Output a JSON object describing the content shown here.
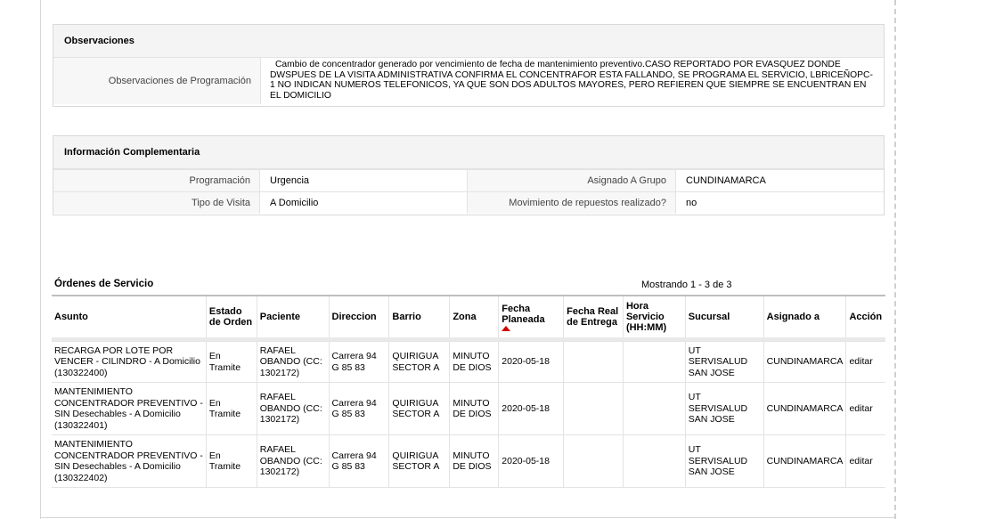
{
  "observaciones": {
    "title": "Observaciones",
    "label": "Observaciones de Programación",
    "text": "Cambio de concentrador generado por vencimiento de fecha de mantenimiento preventivo.CASO REPORTADO POR EVASQUEZ DONDE DWSPUES DE LA VISITA ADMINISTRATIVA CONFIRMA EL CONCENTRAFOR ESTA FALLANDO, SE PROGRAMA EL SERVICIO, LBRICEÑOPC-1 NO INDICAN NUMEROS TELEFONICOS, YA QUE SON DOS ADULTOS MAYORES, PERO REFIEREN QUE SIEMPRE SE ENCUENTRAN EN EL DOMICILIO"
  },
  "info": {
    "title": "Información Complementaria",
    "rows": [
      {
        "label1": "Programación",
        "value1": "Urgencia",
        "label2": "Asignado A Grupo",
        "value2": "CUNDINAMARCA"
      },
      {
        "label1": "Tipo de Visita",
        "value1": "A Domicilio",
        "label2": "Movimiento de repuestos realizado?",
        "value2": "no"
      }
    ]
  },
  "orders": {
    "title": "Órdenes de Servicio",
    "count_text": "Mostrando 1 - 3 de 3",
    "headers": [
      "Asunto",
      "Estado de Orden",
      "Paciente",
      "Direccion",
      "Barrio",
      "Zona",
      "Fecha Planeada",
      "Fecha Real de Entrega",
      "Hora Servicio (HH:MM)",
      "Sucursal",
      "Asignado a",
      "Acción"
    ],
    "rows": [
      {
        "asunto": "RECARGA POR LOTE POR VENCER - CILINDRO - A Domicilio (130322400)",
        "estado": "En Tramite",
        "paciente": "RAFAEL OBANDO (CC: 1302172)",
        "direccion": "Carrera 94 G 85 83",
        "barrio": "QUIRIGUA SECTOR A",
        "zona": "MINUTO DE DIOS",
        "fecha": "2020-05-18",
        "fecha_real": "",
        "hora": "",
        "sucursal": "UT SERVISALUD SAN JOSE",
        "asignado": "CUNDINAMARCA",
        "accion": "editar"
      },
      {
        "asunto": "MANTENIMIENTO CONCENTRADOR PREVENTIVO - SIN Desechables - A Domicilio (130322401)",
        "estado": "En Tramite",
        "paciente": "RAFAEL OBANDO (CC: 1302172)",
        "direccion": "Carrera 94 G 85 83",
        "barrio": "QUIRIGUA SECTOR A",
        "zona": "MINUTO DE DIOS",
        "fecha": "2020-05-18",
        "fecha_real": "",
        "hora": "",
        "sucursal": "UT SERVISALUD SAN JOSE",
        "asignado": "CUNDINAMARCA",
        "accion": "editar"
      },
      {
        "asunto": "MANTENIMIENTO CONCENTRADOR PREVENTIVO - SIN Desechables - A Domicilio (130322402)",
        "estado": "En Tramite",
        "paciente": "RAFAEL OBANDO (CC: 1302172)",
        "direccion": "Carrera 94 G 85 83",
        "barrio": "QUIRIGUA SECTOR A",
        "zona": "MINUTO DE DIOS",
        "fecha": "2020-05-18",
        "fecha_real": "",
        "hora": "",
        "sucursal": "UT SERVISALUD SAN JOSE",
        "asignado": "CUNDINAMARCA",
        "accion": "editar"
      }
    ]
  }
}
